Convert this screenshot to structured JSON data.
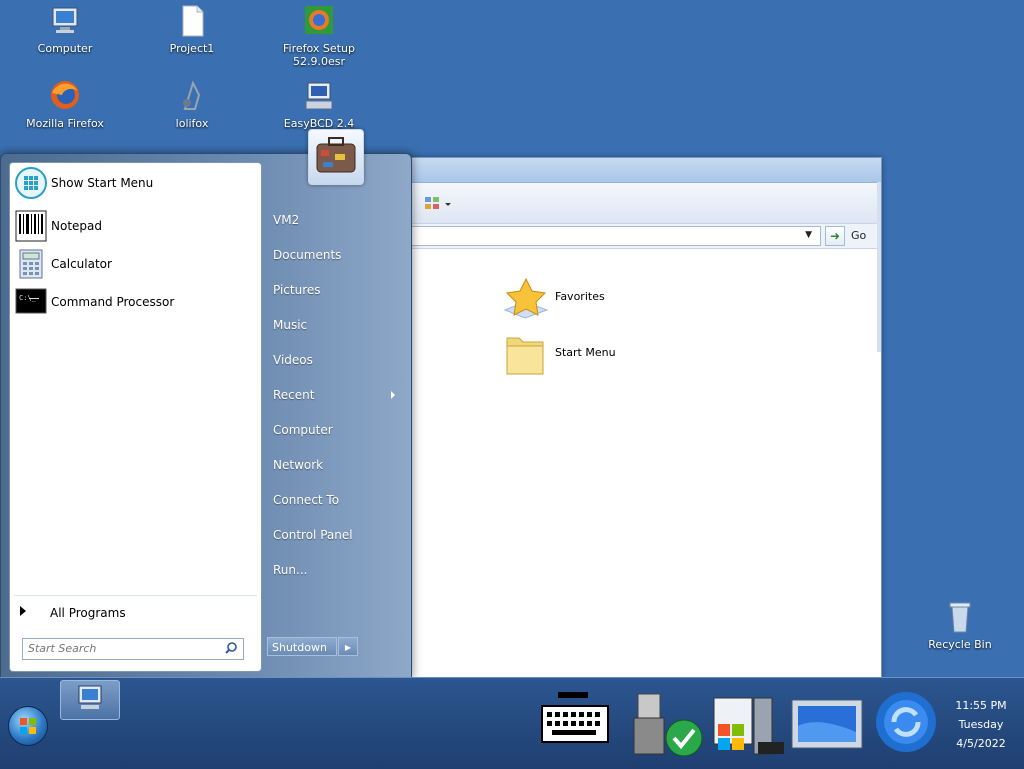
{
  "desktop": {
    "icons": [
      {
        "label": "Computer"
      },
      {
        "label": "Project1"
      },
      {
        "label": "Firefox Setup 52.9.0esr"
      },
      {
        "label": "Mozilla Firefox"
      },
      {
        "label": "lolifox"
      },
      {
        "label": "EasyBCD 2.4"
      },
      {
        "label": "Recycle Bin"
      }
    ]
  },
  "explorer": {
    "go_label": "Go",
    "items": [
      {
        "label": "Favorites"
      },
      {
        "label": "Start Menu"
      }
    ]
  },
  "start_menu": {
    "programs": [
      {
        "label": "Show Start Menu"
      },
      {
        "label": "Notepad"
      },
      {
        "label": "Calculator"
      },
      {
        "label": "Command Processor"
      }
    ],
    "all_programs": "All Programs",
    "search_placeholder": "Start Search",
    "right_items": [
      {
        "label": "VM2"
      },
      {
        "label": "Documents"
      },
      {
        "label": "Pictures"
      },
      {
        "label": "Music"
      },
      {
        "label": "Videos"
      },
      {
        "label": "Recent"
      },
      {
        "label": "Computer"
      },
      {
        "label": "Network"
      },
      {
        "label": "Connect To"
      },
      {
        "label": "Control Panel"
      },
      {
        "label": "Run..."
      }
    ],
    "shutdown_label": "Shutdown"
  },
  "taskbar": {
    "clock": {
      "time": "11:55 PM",
      "day": "Tuesday",
      "date": "4/5/2022"
    }
  }
}
